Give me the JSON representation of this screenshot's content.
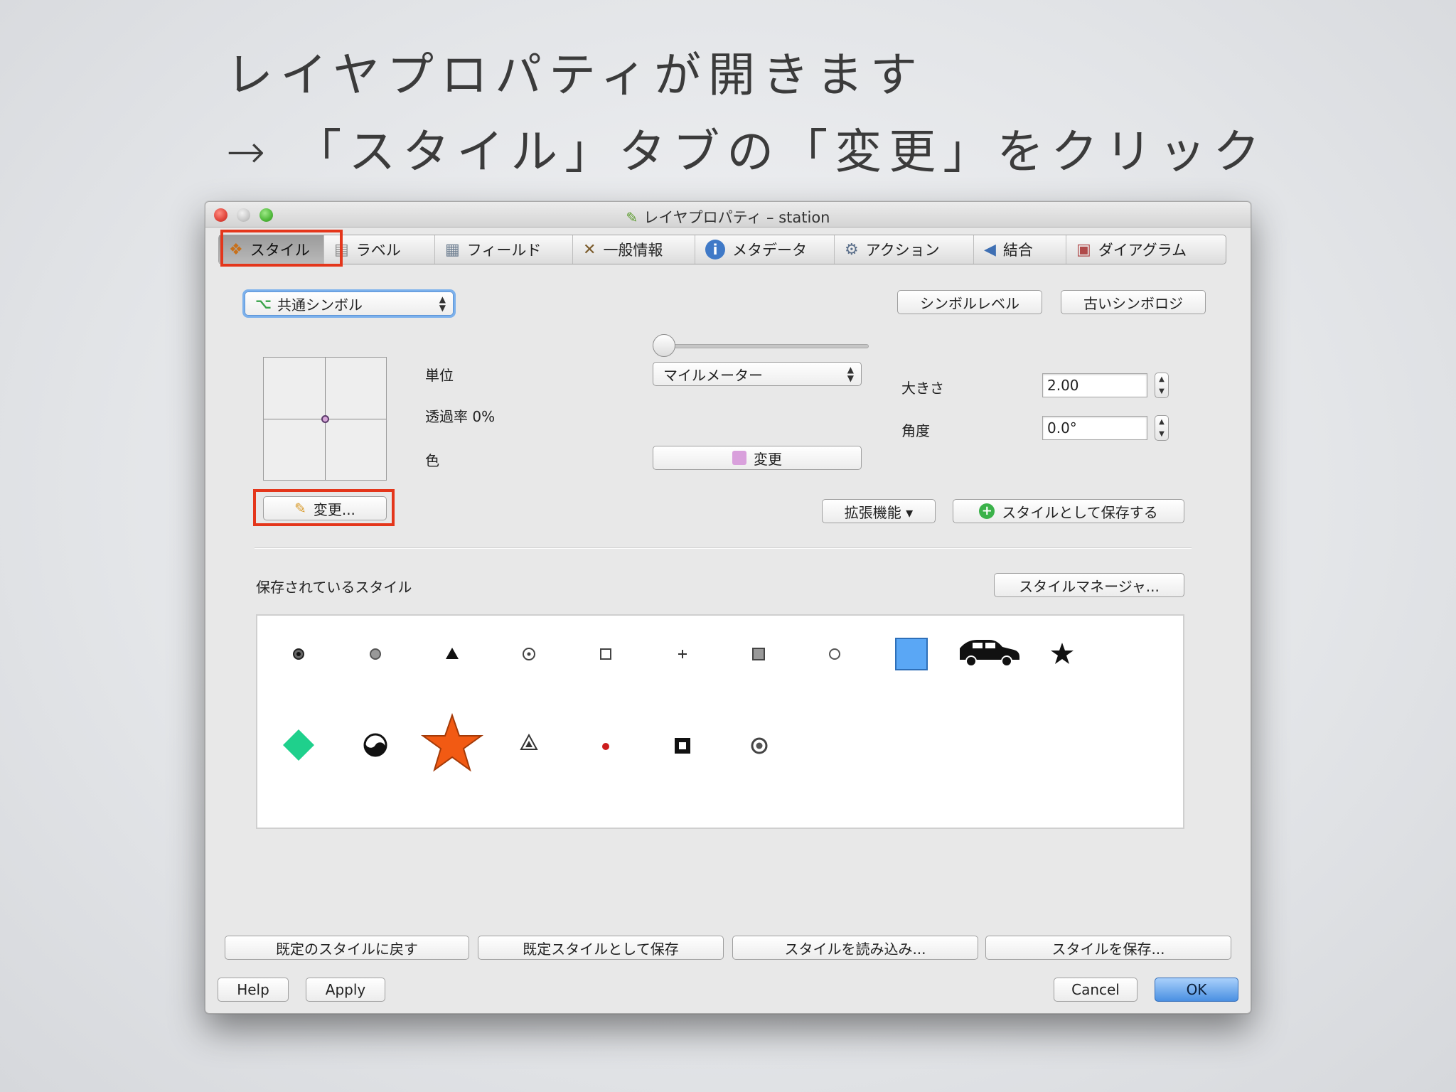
{
  "slide": {
    "line1": "レイヤプロパティが開きます",
    "line2": "→ 「スタイル」タブの「変更」をクリック"
  },
  "window": {
    "title": "レイヤプロパティ – station"
  },
  "tabs": [
    {
      "label": "スタイル",
      "icon": "style-icon"
    },
    {
      "label": "ラベル",
      "icon": "label-icon"
    },
    {
      "label": "フィールド",
      "icon": "table-icon"
    },
    {
      "label": "一般情報",
      "icon": "tools-icon"
    },
    {
      "label": "メタデータ",
      "icon": "info-icon"
    },
    {
      "label": "アクション",
      "icon": "gears-icon"
    },
    {
      "label": "結合",
      "icon": "join-icon"
    },
    {
      "label": "ダイアグラム",
      "icon": "diagram-icon"
    }
  ],
  "style": {
    "renderer": "共通シンボル",
    "symbol_levels_button": "シンボルレベル",
    "old_symbology_button": "古いシンボロジ",
    "unit_label": "単位",
    "unit_value": "マイルメーター",
    "transparency_label": "透過率 0%",
    "transparency_value": 0,
    "color_label": "色",
    "color_change_button": "変更",
    "color_swatch": "#d9a0dc",
    "size_label": "大きさ",
    "size_value": "2.00",
    "angle_label": "角度",
    "angle_value": "0.0°",
    "change_button": "変更...",
    "advanced_button": "拡張機能 ▾",
    "save_as_style_button": "スタイルとして保存する",
    "saved_styles_label": "保存されているスタイル",
    "style_manager_button": "スタイルマネージャ..."
  },
  "symbols": [
    "dot-circle-symbol",
    "gray-circle-symbol",
    "triangle-symbol",
    "target-symbol",
    "square-outline-symbol",
    "cross-symbol",
    "gray-square-symbol",
    "circle-outline-symbol",
    "blue-square-symbol",
    "car-symbol",
    "star-symbol",
    "green-diamond-symbol",
    "yin-yang-symbol",
    "orange-star-symbol",
    "triangle-outline-symbol",
    "red-dot-symbol",
    "square-frame-symbol",
    "ring-symbol"
  ],
  "bottom": {
    "restore_default": "既定のスタイルに戻す",
    "save_default": "既定スタイルとして保存",
    "load_style": "スタイルを読み込み...",
    "save_style": "スタイルを保存...",
    "help": "Help",
    "apply": "Apply",
    "cancel": "Cancel",
    "ok": "OK"
  },
  "colors": {
    "highlight": "#e4361b",
    "accent": "#4a90e2"
  }
}
